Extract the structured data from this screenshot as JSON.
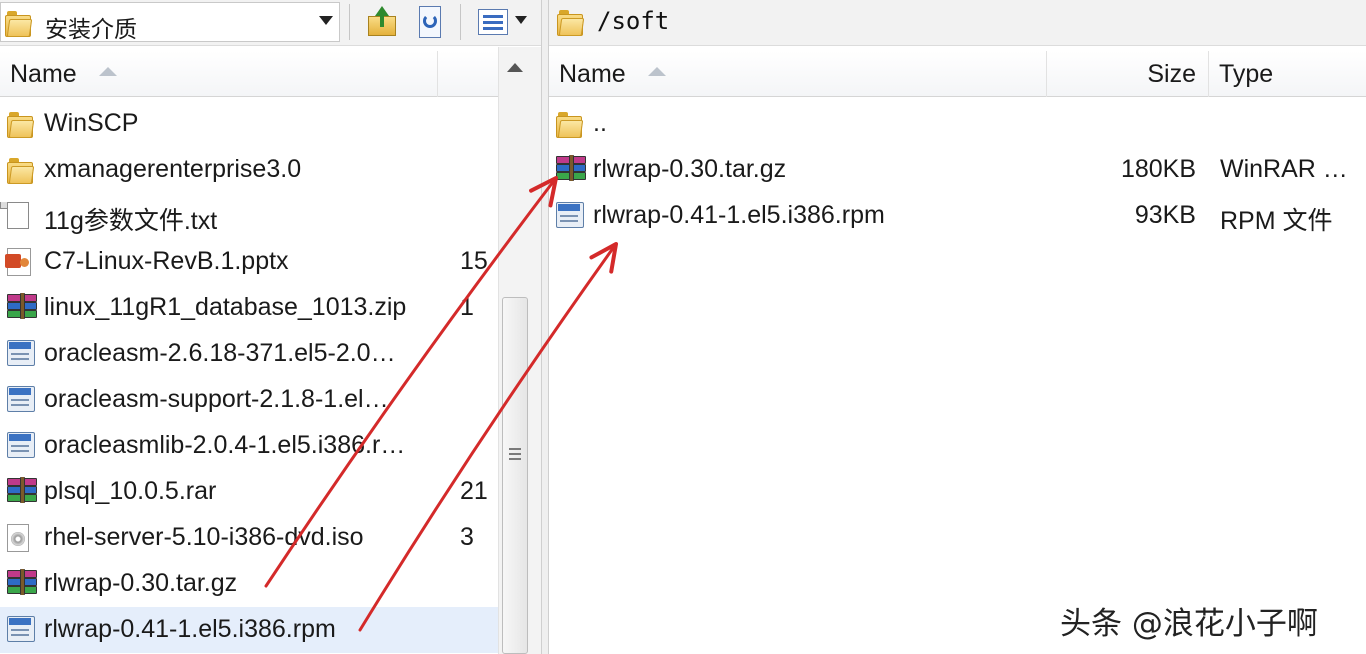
{
  "left_toolbar": {
    "location_value": "安装介质",
    "buttons": {
      "parent_dir": "parent-directory",
      "refresh": "refresh",
      "view": "view-options"
    }
  },
  "right_toolbar": {
    "path": "/soft"
  },
  "left_panel": {
    "columns": {
      "name": "Name"
    },
    "rows": [
      {
        "name": "WinSCP",
        "size": "",
        "icon": "folder-icon"
      },
      {
        "name": "xmanagerenterprise3.0",
        "size": "",
        "icon": "folder-icon"
      },
      {
        "name": "11g参数文件.txt",
        "size": "",
        "icon": "text-file-icon"
      },
      {
        "name": "C7-Linux-RevB.1.pptx",
        "size": "15",
        "icon": "powerpoint-icon"
      },
      {
        "name": "linux_11gR1_database_1013.zip",
        "size": "1",
        "icon": "archive-icon"
      },
      {
        "name": "oracleasm-2.6.18-371.el5-2.0…",
        "size": "",
        "icon": "rpm-icon"
      },
      {
        "name": "oracleasm-support-2.1.8-1.el…",
        "size": "",
        "icon": "rpm-icon"
      },
      {
        "name": "oracleasmlib-2.0.4-1.el5.i386.r…",
        "size": "",
        "icon": "rpm-icon"
      },
      {
        "name": "plsql_10.0.5.rar",
        "size": "21",
        "icon": "archive-icon"
      },
      {
        "name": "rhel-server-5.10-i386-dvd.iso",
        "size": "3",
        "icon": "disc-image-icon"
      },
      {
        "name": "rlwrap-0.30.tar.gz",
        "size": "",
        "icon": "archive-icon"
      },
      {
        "name": "rlwrap-0.41-1.el5.i386.rpm",
        "size": "",
        "icon": "rpm-icon"
      }
    ]
  },
  "right_panel": {
    "columns": {
      "name": "Name",
      "size": "Size",
      "type": "Type"
    },
    "rows": [
      {
        "name": "..",
        "size": "",
        "type": "",
        "icon": "folder-icon"
      },
      {
        "name": "rlwrap-0.30.tar.gz",
        "size": "180KB",
        "type": "WinRAR …",
        "icon": "archive-icon"
      },
      {
        "name": "rlwrap-0.41-1.el5.i386.rpm",
        "size": "93KB",
        "type": "RPM 文件",
        "icon": "rpm-icon"
      }
    ]
  },
  "annotation_color": "#d42a2a",
  "watermark": "头条 @浪花小子啊"
}
